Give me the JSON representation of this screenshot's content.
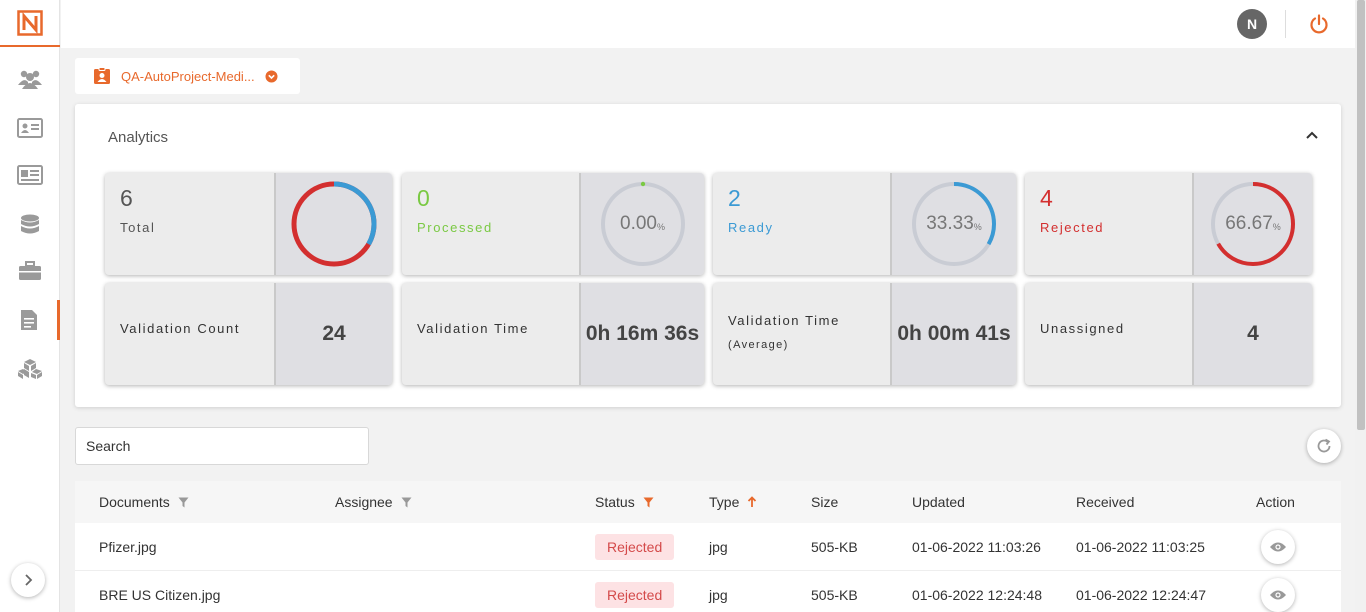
{
  "header": {
    "avatar_initial": "N"
  },
  "project": {
    "name": "QA-AutoProject-Medi..."
  },
  "analytics": {
    "title": "Analytics",
    "stats": [
      {
        "value": "6",
        "label": "Total",
        "color": "#555555"
      },
      {
        "value": "0",
        "label": "Processed",
        "color": "#7ac943",
        "percent": "0.00",
        "unit": "%"
      },
      {
        "value": "2",
        "label": "Ready",
        "color": "#3b9ad4",
        "percent": "33.33",
        "unit": "%"
      },
      {
        "value": "4",
        "label": "Rejected",
        "color": "#d32f2f",
        "percent": "66.67",
        "unit": "%"
      }
    ],
    "metrics": [
      {
        "label": "Validation Count",
        "value": "24"
      },
      {
        "label": "Validation Time",
        "value": "0h 16m 36s"
      },
      {
        "label": "Validation Time",
        "sublabel": "(Average)",
        "value": "0h 00m 41s"
      },
      {
        "label": "Unassigned",
        "value": "4"
      }
    ]
  },
  "search": {
    "placeholder": "Search"
  },
  "table": {
    "columns": [
      "Documents",
      "Assignee",
      "Status",
      "Type",
      "Size",
      "Updated",
      "Received",
      "Action"
    ],
    "rows": [
      {
        "document": "Pfizer.jpg",
        "assignee": "",
        "status": "Rejected",
        "type": "jpg",
        "size": "505-KB",
        "updated": "01-06-2022 11:03:26",
        "received": "01-06-2022 11:03:25"
      },
      {
        "document": "BRE US Citizen.jpg",
        "assignee": "",
        "status": "Rejected",
        "type": "jpg",
        "size": "505-KB",
        "updated": "01-06-2022 12:24:48",
        "received": "01-06-2022 12:24:47"
      }
    ]
  },
  "colors": {
    "accent": "#e8692c",
    "processed": "#7ac943",
    "ready": "#3b9ad4",
    "rejected": "#d32f2f"
  }
}
